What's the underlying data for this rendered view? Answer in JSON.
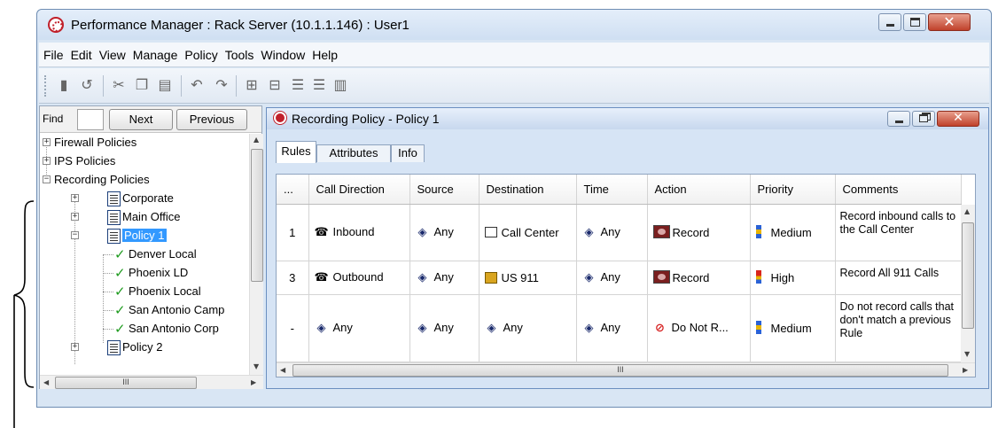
{
  "window": {
    "title": "Performance Manager : Rack Server (10.1.1.146) : User1"
  },
  "menu": [
    "File",
    "Edit",
    "View",
    "Manage",
    "Policy",
    "Tools",
    "Window",
    "Help"
  ],
  "find_bar": {
    "label": "Find",
    "input_value": "",
    "next_label": "Next",
    "previous_label": "Previous"
  },
  "tree": {
    "nodes": [
      {
        "label": "Firewall Policies",
        "expander": "+"
      },
      {
        "label": "IPS Policies",
        "expander": "+"
      },
      {
        "label": "Recording Policies",
        "expander": "−"
      },
      {
        "label": "Corporate",
        "expander": "+"
      },
      {
        "label": "Main Office",
        "expander": "+"
      },
      {
        "label": "Policy 1",
        "expander": "−",
        "selected": true
      },
      {
        "label": "Denver Local"
      },
      {
        "label": "Phoenix LD"
      },
      {
        "label": "Phoenix Local"
      },
      {
        "label": "San Antonio Camp"
      },
      {
        "label": "San Antonio Corp"
      },
      {
        "label": "Policy 2",
        "expander": "+"
      }
    ]
  },
  "inner_window": {
    "title": "Recording Policy - Policy 1",
    "tabs": [
      "Rules",
      "Attributes",
      "Info"
    ],
    "active_tab": "Rules"
  },
  "grid": {
    "columns": [
      "...",
      "Call Direction",
      "Source",
      "Destination",
      "Time",
      "Action",
      "Priority",
      "Comments"
    ],
    "rows": [
      {
        "num": "1",
        "direction": "Inbound",
        "source": "Any",
        "destination": "Call Center",
        "time": "Any",
        "action": "Record",
        "priority": "Medium",
        "comments": "Record inbound calls to the Call Center"
      },
      {
        "num": "3",
        "direction": "Outbound",
        "source": "Any",
        "destination": "US 911",
        "time": "Any",
        "action": "Record",
        "priority": "High",
        "comments": "Record All 911 Calls"
      },
      {
        "num": "-",
        "direction": "Any",
        "source": "Any",
        "destination": "Any",
        "time": "Any",
        "action": "Do Not R...",
        "priority": "Medium",
        "comments": "Do not record calls that don't match a previous Rule"
      }
    ]
  },
  "scroll_thumb_glyph": "III",
  "colors": {
    "selection": "#3399ff",
    "close_button": "#c0412b",
    "check_green": "#1f9b1f",
    "priority_high": "#d9261c",
    "priority_medium": "#e8b400",
    "priority_low": "#2a62d6"
  }
}
